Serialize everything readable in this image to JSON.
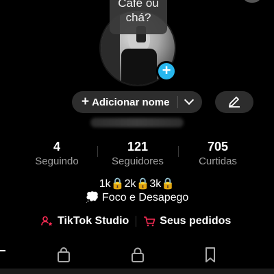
{
  "profile": {
    "bubble_text": "Café ou\nchá?",
    "add_name_label": "Adicionar nome"
  },
  "stats": [
    {
      "value": "4",
      "label": "Seguindo"
    },
    {
      "value": "121",
      "label": "Seguidores"
    },
    {
      "value": "705",
      "label": "Curtidas"
    }
  ],
  "bio": {
    "line1": "1k🔒2k🔒3k🔒",
    "line2": "💭 Foco e Desapego"
  },
  "links": {
    "studio": "TikTok Studio",
    "orders": "Seus pedidos"
  },
  "icons": {
    "add_avatar": "plus-icon",
    "edit": "pencil-icon",
    "tabs": [
      "shopping-bag-icon",
      "lock-icon",
      "bookmark-icon"
    ]
  },
  "colors": {
    "accent_blue": "#27b7ee",
    "accent_red": "#fe2c55"
  }
}
